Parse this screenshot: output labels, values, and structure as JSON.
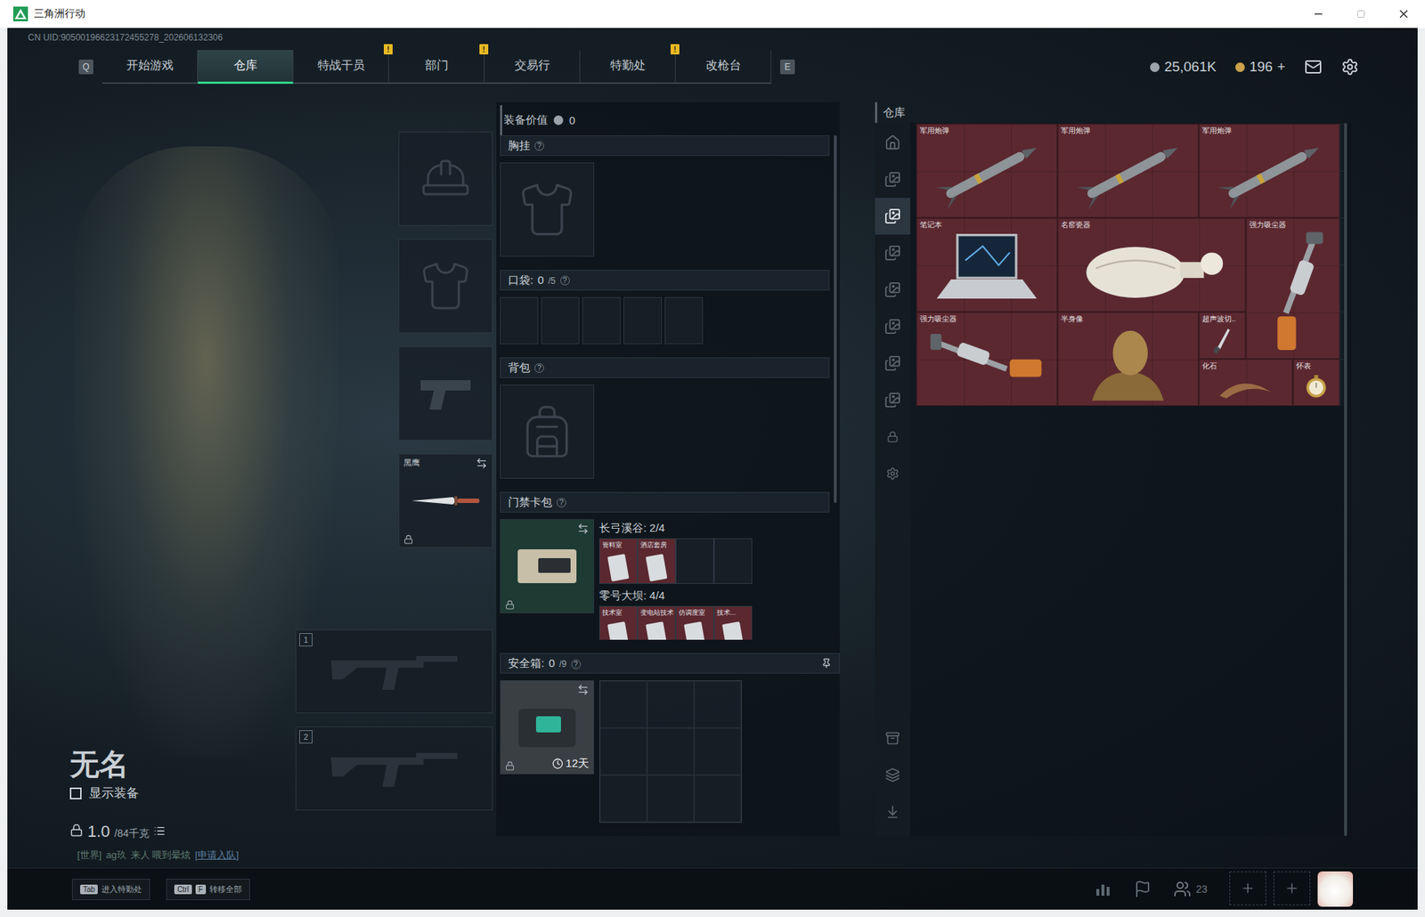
{
  "window": {
    "title": "三角洲行动"
  },
  "uid": "CN UID:90500196623172455278_202606132306",
  "nav": {
    "prev_key": "Q",
    "next_key": "E",
    "alert_mark": "!",
    "tabs": [
      {
        "label": "开始游戏",
        "selected": false,
        "alert": false
      },
      {
        "label": "仓库",
        "selected": true,
        "alert": false
      },
      {
        "label": "特战干员",
        "selected": false,
        "alert": true
      },
      {
        "label": "部门",
        "selected": false,
        "alert": true
      },
      {
        "label": "交易行",
        "selected": false,
        "alert": false
      },
      {
        "label": "特勤处",
        "selected": false,
        "alert": true
      },
      {
        "label": "改枪台",
        "selected": false,
        "alert": false
      }
    ]
  },
  "currencies": [
    {
      "kind": "coin",
      "amount": "25,061K"
    },
    {
      "kind": "token",
      "amount": "196",
      "action": "+"
    }
  ],
  "character": {
    "name": "无名",
    "show_gear": {
      "label": "显示装备",
      "checked": false
    },
    "weight": "1.0",
    "weight_max": "/84千克",
    "chat": {
      "channel": "[世界]",
      "sender": "ag玖",
      "message": "来人 喂到晕炫",
      "link": "[申请入队]"
    }
  },
  "gear_slots": [
    {
      "kind": "helmet",
      "locked": false,
      "swappable": false
    },
    {
      "kind": "armor",
      "locked": false,
      "swappable": false
    },
    {
      "kind": "pistol",
      "locked": false,
      "swappable": false
    },
    {
      "kind": "melee",
      "label": "黑鹰",
      "locked": true,
      "swappable": true
    }
  ],
  "weapon_slots": [
    {
      "number": "1"
    },
    {
      "number": "2"
    }
  ],
  "loadout": {
    "value_label": "装备价值",
    "value": "0",
    "chest": {
      "title": "胸挂",
      "help": "?"
    },
    "pockets": {
      "title": "口袋:",
      "count": "0",
      "capacity": "/5",
      "help": "?",
      "slots": 5
    },
    "backpack": {
      "title": "背包",
      "help": "?"
    },
    "keycards": {
      "title": "门禁卡包",
      "help": "?",
      "locked": true,
      "swappable": true,
      "maps": [
        {
          "name": "长弓溪谷: 2/4",
          "slots": 4,
          "cards": [
            {
              "label": "资料室"
            },
            {
              "label": "酒店套房"
            }
          ]
        },
        {
          "name": "零号大坝: 4/4",
          "slots": 4,
          "cards": [
            {
              "label": "技术室"
            },
            {
              "label": "变电站技术"
            },
            {
              "label": "仿调度室"
            },
            {
              "label": "技术..."
            }
          ]
        }
      ]
    },
    "safebox": {
      "title": "安全箱:",
      "count": "0",
      "capacity": "/9",
      "help": "?",
      "timer": "12天",
      "locked": true,
      "swappable": true,
      "slots": 9
    }
  },
  "warehouse": {
    "title": "仓库",
    "tabs": [
      {
        "kind": "home",
        "selected": false
      },
      {
        "kind": "storage",
        "selected": false
      },
      {
        "kind": "storage",
        "selected": true
      },
      {
        "kind": "storage",
        "selected": false
      },
      {
        "kind": "storage",
        "selected": false
      },
      {
        "kind": "storage",
        "selected": false
      },
      {
        "kind": "storage",
        "selected": false
      },
      {
        "kind": "storage",
        "selected": false
      },
      {
        "kind": "lock",
        "selected": false
      },
      {
        "kind": "settings",
        "selected": false
      }
    ],
    "tools": [
      {
        "kind": "tidy"
      },
      {
        "kind": "layers"
      },
      {
        "kind": "transfer"
      }
    ],
    "items": [
      {
        "name": "军用炮弹",
        "kind": "missile"
      },
      {
        "name": "军用炮弹",
        "kind": "missile"
      },
      {
        "name": "军用炮弹",
        "kind": "missile"
      },
      {
        "name": "笔记本",
        "kind": "laptop"
      },
      {
        "name": "名窑瓷器",
        "kind": "vase"
      },
      {
        "name": "强力吸尘器",
        "kind": "vacuum"
      },
      {
        "name": "强力吸尘器",
        "kind": "vacuum"
      },
      {
        "name": "半身像",
        "kind": "bust"
      },
      {
        "name": "超声波切..",
        "kind": "knife"
      },
      {
        "name": "化石",
        "kind": "fossil"
      },
      {
        "name": "怀表",
        "kind": "watch"
      }
    ]
  },
  "bottom_bar": {
    "hints": [
      {
        "keys": [
          "Tab"
        ],
        "label": "进入特勤处"
      },
      {
        "keys": [
          "Ctrl",
          "F"
        ],
        "label": "转移全部"
      }
    ],
    "friends_count": "23",
    "party_slots": 2
  }
}
